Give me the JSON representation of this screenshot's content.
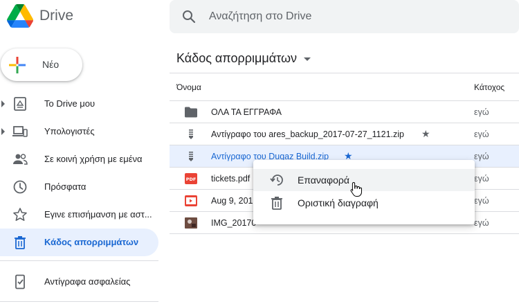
{
  "app": {
    "brand": "Drive"
  },
  "search": {
    "placeholder": "Αναζήτηση στο Drive"
  },
  "new_button": {
    "label": "Νέο"
  },
  "sidebar": {
    "items": [
      {
        "label": "Το Drive μου",
        "icon": "my-drive-icon",
        "expandable": true
      },
      {
        "label": "Υπολογιστές",
        "icon": "computers-icon",
        "expandable": true
      },
      {
        "label": "Σε κοινή χρήση με εμένα",
        "icon": "shared-icon"
      },
      {
        "label": "Πρόσφατα",
        "icon": "clock-icon"
      },
      {
        "label": "Εγινε επισήμανση με αστ...",
        "icon": "star-icon"
      },
      {
        "label": "Κάδος απορριμμάτων",
        "icon": "trash-icon",
        "active": true
      },
      {
        "label": "Αντίγραφα ασφαλείας",
        "icon": "backups-icon"
      }
    ]
  },
  "main": {
    "title": "Κάδος απορριμμάτων",
    "columns": {
      "name": "Όνομα",
      "owner": "Κάτοχος"
    },
    "files": [
      {
        "name": "ΟΛΑ ΤΑ ΕΓΓΡΑΦΑ",
        "type": "folder",
        "owner": "εγώ"
      },
      {
        "name": "Αντίγραφο του ares_backup_2017-07-27_1121.zip",
        "type": "zip",
        "starred": true,
        "owner": "εγώ"
      },
      {
        "name": "Αντίγραφο του Duqaz Build.zip",
        "type": "zip",
        "starred": true,
        "selected": true,
        "owner": "εγώ"
      },
      {
        "name": "tickets.pdf",
        "type": "pdf",
        "owner": "εγώ"
      },
      {
        "name": "Aug 9, 201",
        "type": "video",
        "owner": "εγώ"
      },
      {
        "name": "IMG_20170",
        "type": "image",
        "owner": "εγώ"
      }
    ]
  },
  "context_menu": {
    "items": [
      {
        "label": "Επαναφορά",
        "icon": "restore-icon"
      },
      {
        "label": "Οριστική διαγραφή",
        "icon": "delete-forever-icon"
      }
    ]
  },
  "colors": {
    "accent": "#1967d2",
    "selected_bg": "#e8f0fe",
    "pdf_red": "#ea4335"
  }
}
